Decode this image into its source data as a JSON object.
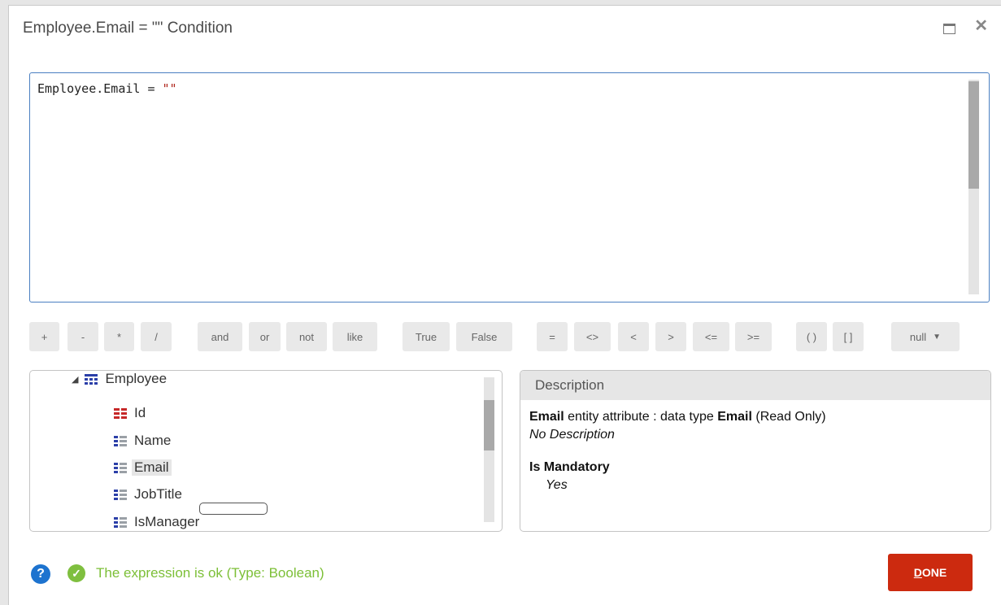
{
  "dialog": {
    "title": "Employee.Email = \"\" Condition"
  },
  "editor": {
    "code_prefix": "Employee.Email = ",
    "code_string": "\"\""
  },
  "operators": [
    {
      "label": "+",
      "name": "op-plus"
    },
    {
      "label": "-",
      "name": "op-minus"
    },
    {
      "label": "*",
      "name": "op-multiply"
    },
    {
      "label": "/",
      "name": "op-divide"
    },
    {
      "label": "and",
      "name": "op-and"
    },
    {
      "label": "or",
      "name": "op-or"
    },
    {
      "label": "not",
      "name": "op-not"
    },
    {
      "label": "like",
      "name": "op-like"
    },
    {
      "label": "True",
      "name": "op-true"
    },
    {
      "label": "False",
      "name": "op-false"
    },
    {
      "label": "=",
      "name": "op-equals"
    },
    {
      "label": "<>",
      "name": "op-not-equals"
    },
    {
      "label": "<",
      "name": "op-less"
    },
    {
      "label": ">",
      "name": "op-greater"
    },
    {
      "label": "<=",
      "name": "op-less-equal"
    },
    {
      "label": ">=",
      "name": "op-greater-equal"
    },
    {
      "label": "( )",
      "name": "op-parens"
    },
    {
      "label": "[ ]",
      "name": "op-brackets"
    }
  ],
  "null_op": {
    "label": "null"
  },
  "tree": {
    "root": "Employee",
    "items": [
      "Id",
      "Name",
      "Email",
      "JobTitle",
      "IsManager"
    ],
    "selected": "Email"
  },
  "description": {
    "header": "Description",
    "attr_name": "Email",
    "attr_mid": " entity attribute : data type ",
    "attr_type": "Email",
    "attr_suffix": " (Read Only)",
    "no_desc": "No Description",
    "mandatory_label": "Is Mandatory",
    "mandatory_value": "Yes"
  },
  "footer": {
    "help": "?",
    "status": "The expression is ok (Type: Boolean)",
    "done_first": "D",
    "done_rest": "ONE"
  },
  "colors": {
    "done_bg": "#cc2a0f",
    "status_text": "#7cbf37",
    "help_icon": "#1d73cf",
    "editor_border": "#4a7fc1"
  }
}
